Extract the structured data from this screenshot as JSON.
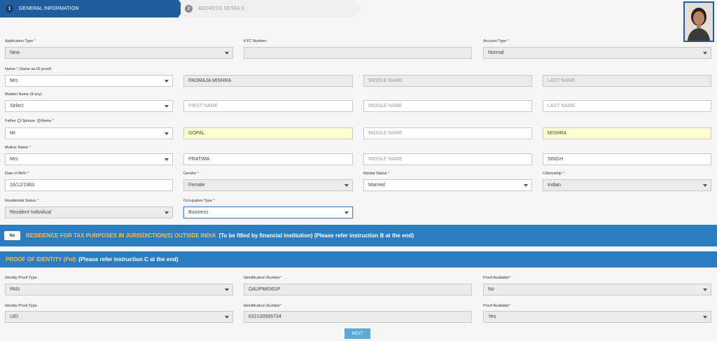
{
  "steps": [
    {
      "num": "1",
      "label": "GENERAL INFORMATION"
    },
    {
      "num": "2",
      "label": "ADDRESS DETAILS"
    }
  ],
  "row1": {
    "application_type": {
      "label": "Application Type",
      "value": "New"
    },
    "kyc_number": {
      "label": "KYC Number",
      "value": ""
    },
    "account_type": {
      "label": "Account Type",
      "value": "Normal"
    }
  },
  "name": {
    "label": "Name",
    "label_note": "(Same as ID proof)",
    "prefix": "Mrs",
    "first": "PADMAJA MISHRA",
    "middle_placeholder": "MIDDLE NAME",
    "last_placeholder": "LAST NAME"
  },
  "maiden": {
    "label": "Maiden Name (If any)",
    "prefix": "Select",
    "first_placeholder": "FIRST NAME",
    "middle_placeholder": "MIDDLE NAME",
    "last_placeholder": "LAST NAME"
  },
  "father_spouse": {
    "label_a": "Father",
    "label_b": "Spouse",
    "label_c": "Name",
    "prefix": "Mr",
    "first": "GOPAL",
    "middle_placeholder": "MIDDLE NAME",
    "last": "MISHRA"
  },
  "mother": {
    "label": "Mother Name",
    "prefix": "Mrs",
    "first": "PRATIMA",
    "middle_placeholder": "MIDDLE NAME",
    "last": "SINGH"
  },
  "row_dob": {
    "dob": {
      "label": "Date of Birth",
      "value": "16/12/1983"
    },
    "gender": {
      "label": "Gender",
      "value": "Female"
    },
    "marital": {
      "label": "Marital Status",
      "value": "Married"
    },
    "citizenship": {
      "label": "Citizenship",
      "value": "Indian"
    }
  },
  "row_res": {
    "residential": {
      "label": "Residential Status",
      "value": "Resident Individual"
    },
    "occupation": {
      "label": "Occupation Type",
      "value": "Business"
    }
  },
  "tax_bar": {
    "toggle": "No",
    "title": "RESIDENCE FOR TAX PURPOSES IN JURISDICTION(S) OUTSIDE INDIA",
    "note": "(To be filled by financial institution) (Please refer instruction B at the end)"
  },
  "poi_bar": {
    "title": "PROOF OF IDENTITY (PoI)",
    "note": "(Please refer instruction C at the end)"
  },
  "poi_rows": [
    {
      "type_label": "Identity Proof Type",
      "type_value": "PAN",
      "id_label": "Identification Number",
      "id_value": "DAUPM6361P",
      "avail_label": "Proof Available",
      "avail_value": "No"
    },
    {
      "type_label": "Identity Proof Type",
      "type_value": "UID",
      "id_label": "Identification Number",
      "id_value": "632100595734",
      "avail_label": "Proof Available",
      "avail_value": "Yes"
    }
  ],
  "next_label": "NEXT",
  "colors": {
    "primary": "#1f5f9f",
    "section_bar": "#2b7dc0",
    "title_gold": "#f5c242",
    "highlight": "#ffffd2"
  }
}
